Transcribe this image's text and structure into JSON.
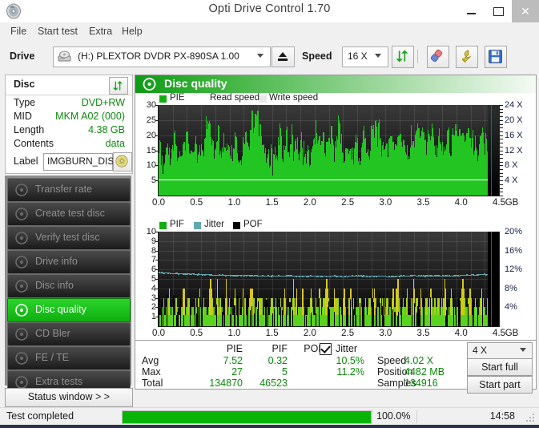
{
  "window": {
    "title": "Opti Drive Control 1.70",
    "app_icon": "disc-icon",
    "minimize_label": "–",
    "maximize_label": "□",
    "close_label": "✕"
  },
  "menu": {
    "items": [
      {
        "label": "File",
        "name": "menu-file"
      },
      {
        "label": "Start test",
        "name": "menu-start-test"
      },
      {
        "label": "Extra",
        "name": "menu-extra"
      },
      {
        "label": "Help",
        "name": "menu-help"
      }
    ]
  },
  "toolbar": {
    "drive_label": "Drive",
    "drive_value": "(H:)  PLEXTOR DVDR  PX-890SA 1.00",
    "eject_name": "eject-button",
    "speed_label": "Speed",
    "speed_value": "16 X",
    "refresh_name": "refresh-button",
    "erase_name": "erase-button",
    "bitsetting_name": "bitsetting-button",
    "save_name": "save-button"
  },
  "disc_panel": {
    "header": "Disc",
    "refresh_name": "disc-refresh-button",
    "rows": [
      {
        "key": "Type",
        "value": "DVD+RW"
      },
      {
        "key": "MID",
        "value": "MKM A02 (000)"
      },
      {
        "key": "Length",
        "value": "4.38 GB"
      },
      {
        "key": "Contents",
        "value": "data"
      }
    ],
    "label_key": "Label",
    "label_value": "IMGBURN_DIS",
    "label_button_name": "disc-label-button"
  },
  "nav": {
    "items": [
      {
        "label": "Transfer rate",
        "active": false
      },
      {
        "label": "Create test disc",
        "active": false
      },
      {
        "label": "Verify test disc",
        "active": false
      },
      {
        "label": "Drive info",
        "active": false
      },
      {
        "label": "Disc info",
        "active": false
      },
      {
        "label": "Disc quality",
        "active": true
      },
      {
        "label": "CD Bler",
        "active": false
      },
      {
        "label": "FE / TE",
        "active": false
      },
      {
        "label": "Extra tests",
        "active": false
      }
    ],
    "status_window_label": "Status window > >"
  },
  "main": {
    "header_title": "Disc quality",
    "header_icon": "disc-quality-icon"
  },
  "results": {
    "columns": [
      "PIE",
      "PIF",
      "POF",
      "Jitter"
    ],
    "jitter_checked": true,
    "rows": [
      {
        "label": "Avg",
        "pie": "7.52",
        "pif": "0.32",
        "pof": "",
        "jitter": "10.5%"
      },
      {
        "label": "Max",
        "pie": "27",
        "pif": "5",
        "pof": "",
        "jitter": "11.2%"
      },
      {
        "label": "Total",
        "pie": "134870",
        "pif": "46523",
        "pof": "",
        "jitter": ""
      }
    ],
    "speed_label": "Speed",
    "speed_value": "4.02 X",
    "position_label": "Position",
    "position_value": "4482 MB",
    "samples_label": "Samples",
    "samples_value": "134916",
    "speed_select_value": "4 X",
    "start_full_label": "Start full",
    "start_part_label": "Start part"
  },
  "statusbar": {
    "text": "Test completed",
    "percent_label": "100.0%",
    "percent_value": 100,
    "time": "14:58"
  },
  "colors": {
    "accent_green": "#0faf0f",
    "pie_green": "#22c522",
    "pif_green": "#5ad21f",
    "jitter_teal": "#63a8b0",
    "pof_black": "#000000",
    "value_green": "#0a8a0a",
    "marker_red": "#ee1111",
    "plot_bg": "#141414"
  },
  "chart_data": [
    {
      "type": "area",
      "name": "pie-chart",
      "title": "PIE",
      "legend": [
        {
          "label": "PIE",
          "color": "#0faf0f"
        },
        {
          "label": "Read speed",
          "color": "#ffffff"
        },
        {
          "label": "Write speed",
          "color": "#e8e8e8"
        }
      ],
      "xlabel": "GB",
      "xlim": [
        0.0,
        4.5
      ],
      "xticks": [
        "0.0",
        "0.5",
        "1.0",
        "1.5",
        "2.0",
        "2.5",
        "3.0",
        "3.5",
        "4.0",
        "4.5"
      ],
      "ylabel_left": "PIE",
      "ylim": [
        0,
        30
      ],
      "yticks": [
        "30",
        "25",
        "20",
        "15",
        "10",
        "5"
      ],
      "ylabel_right": "Speed",
      "ylim_right": [
        0,
        24
      ],
      "yticks_right": [
        "24 X",
        "20 X",
        "16 X",
        "12 X",
        "8 X",
        "4 X"
      ],
      "grid": true,
      "marker_position_gb": 4.39,
      "series": [
        {
          "name": "PIE",
          "color": "#22c522",
          "values": [
            13,
            16,
            10,
            12,
            14,
            17,
            15,
            12,
            13,
            19,
            14,
            11,
            15,
            13,
            18,
            14,
            26,
            16,
            13,
            17,
            14,
            20,
            12,
            15,
            18,
            13,
            15,
            27,
            19,
            26,
            14,
            17,
            12,
            16,
            21,
            14,
            12,
            18,
            15,
            13,
            16,
            12,
            14,
            18,
            20,
            16,
            14,
            12,
            19,
            13,
            22,
            17,
            14,
            26,
            20,
            24,
            27,
            23,
            19,
            15,
            12,
            14,
            13,
            11,
            16,
            9,
            14,
            12,
            17,
            21,
            16,
            14,
            18,
            22,
            15,
            14,
            22,
            13,
            17,
            16,
            12,
            21,
            13,
            15,
            11,
            17,
            12,
            15,
            14,
            18,
            24,
            19,
            15,
            14,
            17,
            12,
            19,
            16,
            14,
            22,
            13,
            16,
            23,
            27,
            18,
            15,
            12,
            14,
            17,
            16,
            11,
            13,
            15,
            19,
            14,
            12,
            16,
            20,
            15,
            18,
            13,
            17,
            25,
            19,
            23,
            20,
            22,
            16,
            13,
            17,
            19,
            14,
            16,
            21,
            13,
            18,
            15,
            24,
            19,
            17,
            14,
            16,
            12,
            15,
            20,
            18,
            14,
            22,
            27,
            21,
            19,
            23,
            17,
            15,
            20,
            16,
            22,
            18,
            14,
            17,
            21,
            15,
            19,
            13,
            16,
            22,
            18,
            14,
            20,
            17,
            23,
            16,
            19,
            15,
            21,
            14,
            18,
            22,
            16,
            20,
            13,
            19,
            15,
            17,
            22,
            18,
            14,
            20,
            16,
            21,
            15,
            19,
            13,
            17,
            14
          ]
        },
        {
          "name": "Read speed",
          "color": "#ffffff",
          "approx_value_x": 4.0,
          "note": "flat read speed trace near 4X"
        }
      ]
    },
    {
      "type": "bar",
      "name": "pif-chart",
      "title": "PIF",
      "legend": [
        {
          "label": "PIF",
          "color": "#0faf0f"
        },
        {
          "label": "Jitter",
          "color": "#63a8b0"
        },
        {
          "label": "POF",
          "color": "#000000"
        }
      ],
      "xlabel": "GB",
      "xlim": [
        0.0,
        4.5
      ],
      "xticks": [
        "0.0",
        "0.5",
        "1.0",
        "1.5",
        "2.0",
        "2.5",
        "3.0",
        "3.5",
        "4.0",
        "4.5"
      ],
      "ylabel_left": "PIF",
      "ylim": [
        0,
        10
      ],
      "yticks": [
        "10",
        "9",
        "8",
        "7",
        "6",
        "5",
        "4",
        "3",
        "2",
        "1"
      ],
      "ylabel_right": "Jitter",
      "ylim_right": [
        0,
        20
      ],
      "yticks_right": [
        "20%",
        "16%",
        "12%",
        "8%",
        "4%"
      ],
      "grid": true,
      "marker_position_gb": 4.39,
      "series": [
        {
          "name": "PIF",
          "color": "#5ad21f",
          "values": [
            2,
            1,
            3,
            2,
            1,
            2,
            3,
            1,
            2,
            1,
            3,
            2,
            1,
            2,
            4,
            1,
            2,
            3,
            1,
            2,
            1,
            3,
            2,
            4,
            1,
            2,
            3,
            1,
            2,
            5,
            3,
            2,
            1,
            4,
            2,
            3,
            1,
            2,
            4,
            1,
            3,
            2,
            1,
            5,
            2,
            3,
            1,
            2,
            4,
            3,
            1,
            2,
            5,
            3,
            2,
            1,
            4,
            2,
            3,
            1,
            2,
            3,
            1,
            2,
            4,
            1,
            3,
            2,
            1,
            3,
            2,
            4,
            1,
            2,
            3,
            1,
            5,
            2,
            3,
            1,
            2,
            4,
            3,
            1,
            2,
            3,
            4,
            2,
            1,
            3,
            2,
            4,
            1,
            3,
            2,
            5,
            3,
            1,
            2,
            4,
            2,
            3,
            1,
            2,
            3,
            4,
            1,
            2,
            5,
            3,
            2,
            1,
            3,
            2,
            4,
            1,
            2,
            3,
            1,
            4,
            2,
            3,
            5,
            2,
            1,
            3,
            2,
            4,
            1,
            3,
            2,
            1,
            4,
            2,
            3,
            5,
            2,
            1,
            3,
            2,
            4,
            1,
            2,
            3,
            5,
            2,
            4,
            1,
            3,
            2,
            1,
            4,
            3,
            2,
            5,
            1,
            3,
            2,
            4,
            1,
            2,
            3,
            5,
            2,
            1,
            4,
            3,
            2,
            1,
            3,
            2,
            4,
            5,
            1,
            3,
            2,
            4,
            1,
            2,
            3,
            1,
            2,
            4,
            3,
            2,
            1,
            5,
            3,
            2,
            4,
            1,
            3,
            2
          ]
        },
        {
          "name": "Jitter",
          "color": "#63a8b0",
          "values_pct": [
            11.2,
            11.1,
            11.0,
            11.0,
            10.9,
            10.9,
            10.8,
            10.8,
            10.7,
            10.7,
            10.6,
            10.6,
            10.6,
            10.6,
            10.6,
            10.5,
            10.5,
            10.5,
            10.5,
            10.5,
            10.5,
            10.4,
            10.5,
            10.5,
            10.4,
            10.4,
            10.5,
            10.4,
            10.4,
            10.5,
            10.5,
            10.4,
            10.4,
            10.5,
            10.4,
            10.4,
            10.5,
            10.5,
            10.6,
            10.5,
            10.5,
            10.6,
            10.5,
            10.5,
            10.6,
            10.6,
            10.7,
            10.7,
            10.8,
            10.8
          ]
        },
        {
          "name": "POF",
          "color": "#000000",
          "values": []
        }
      ]
    }
  ]
}
